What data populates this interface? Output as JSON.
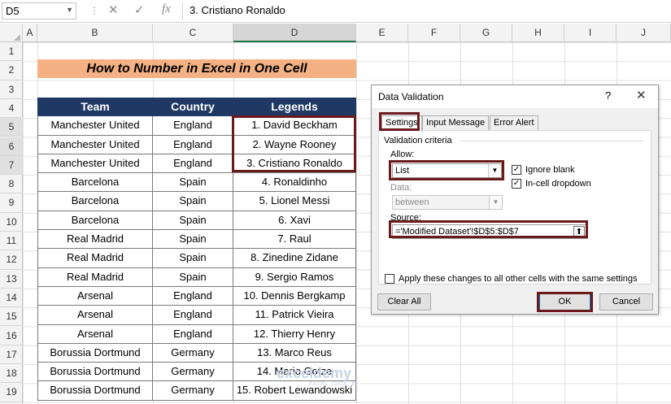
{
  "formula_bar": {
    "name_box": "D5",
    "formula": "3. Cristiano Ronaldo",
    "fx_label": "fx"
  },
  "columns": [
    "A",
    "B",
    "C",
    "D",
    "E",
    "F",
    "G",
    "H",
    "I",
    "J"
  ],
  "rows": [
    "1",
    "2",
    "3",
    "4",
    "5",
    "6",
    "7",
    "8",
    "9",
    "10",
    "11",
    "12",
    "13",
    "14",
    "15",
    "16",
    "17",
    "18",
    "19"
  ],
  "sheet": {
    "title": "How to Number in Excel in One Cell",
    "headers": [
      "Team",
      "Country",
      "Legends"
    ],
    "data": [
      [
        "Manchester United",
        "England",
        "1. David Beckham"
      ],
      [
        "Manchester United",
        "England",
        "2. Wayne Rooney"
      ],
      [
        "Manchester United",
        "England",
        "3. Cristiano Ronaldo"
      ],
      [
        "Barcelona",
        "Spain",
        "4. Ronaldinho"
      ],
      [
        "Barcelona",
        "Spain",
        "5. Lionel Messi"
      ],
      [
        "Barcelona",
        "Spain",
        "6.  Xavi"
      ],
      [
        "Real Madrid",
        "Spain",
        "7. Raul"
      ],
      [
        "Real Madrid",
        "Spain",
        "8. Zinedine Zidane"
      ],
      [
        "Real Madrid",
        "Spain",
        "9. Sergio Ramos"
      ],
      [
        "Arsenal",
        "England",
        "10. Dennis Bergkamp"
      ],
      [
        "Arsenal",
        "England",
        "11. Patrick Vieira"
      ],
      [
        "Arsenal",
        "England",
        "12. Thierry Henry"
      ],
      [
        "Borussia Dortmund",
        "Germany",
        "13. Marco Reus"
      ],
      [
        "Borussia Dortmund",
        "Germany",
        "14. Mario Gotze"
      ],
      [
        "Borussia Dortmund",
        "Germany",
        "15. Robert Lewandowski"
      ]
    ]
  },
  "dialog": {
    "title": "Data Validation",
    "help": "?",
    "close": "✕",
    "tabs": [
      "Settings",
      "Input Message",
      "Error Alert"
    ],
    "criteria_label": "Validation criteria",
    "allow_label": "Allow:",
    "allow_value": "List",
    "ignore_blank_label": "Ignore blank",
    "ignore_blank_checked": true,
    "in_cell_dropdown_label": "In-cell dropdown",
    "in_cell_dropdown_checked": true,
    "data_label": "Data:",
    "data_value": "between",
    "source_label": "Source:",
    "source_value": "='Modified Dataset'!$D$5:$D$7",
    "apply_label": "Apply these changes to all other cells with the same settings",
    "apply_checked": false,
    "clear_all": "Clear All",
    "ok": "OK",
    "cancel": "Cancel"
  },
  "watermark": {
    "name": "exceldemy",
    "tagline": "EXCEL · DATA · BI"
  },
  "colors": {
    "header_bg": "#1f3864",
    "title_bg": "#f4b183",
    "highlight_border": "#6b1a1a"
  }
}
